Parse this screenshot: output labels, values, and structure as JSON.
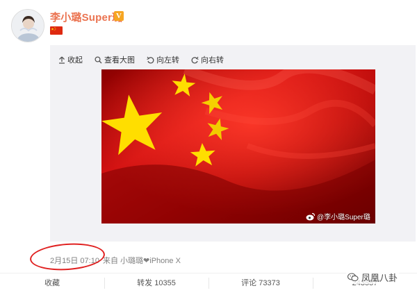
{
  "user": {
    "name": "李小璐Super璐",
    "verified_badge": "V",
    "emoji": "china-flag"
  },
  "toolbar": {
    "collapse_label": "收起",
    "view_large_label": "查看大图",
    "rotate_left_label": "向左转",
    "rotate_right_label": "向右转"
  },
  "image": {
    "subject": "china-flag",
    "watermark": "@李小璐Super璐"
  },
  "meta": {
    "time": "2月15日 07:10",
    "source": "来自 小璐璐❤iPhone X"
  },
  "actions": {
    "favorite_label": "收藏",
    "repost_label": "转发 10355",
    "comment_label": "评论 73373",
    "like_label": "243557"
  },
  "overlay": {
    "site_name": "凤凰八卦"
  },
  "colors": {
    "username": "#eb7350",
    "annotation": "#e02020",
    "flag_red": "#de2910",
    "flag_yellow": "#ffde00"
  }
}
